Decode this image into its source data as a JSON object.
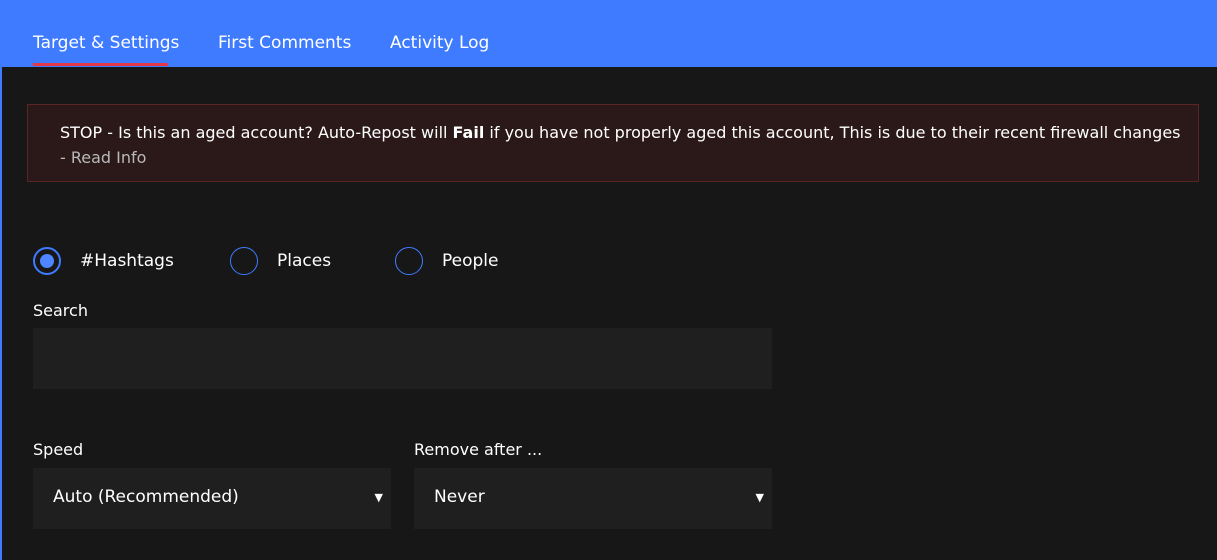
{
  "tabs": {
    "target_settings": "Target & Settings",
    "first_comments": "First Comments",
    "activity_log": "Activity Log"
  },
  "warning": {
    "text_before": "STOP - Is this an aged account? Auto-Repost will ",
    "bold": "Fail",
    "text_after": " if you have not properly aged this account, This is due to their recent firewall changes",
    "link_prefix": "- ",
    "link": "Read Info"
  },
  "target_type": {
    "options": [
      "#Hashtags",
      "Places",
      "People"
    ],
    "selected": "#Hashtags"
  },
  "search": {
    "label": "Search",
    "value": "",
    "placeholder": ""
  },
  "speed": {
    "label": "Speed",
    "value": "Auto (Recommended)"
  },
  "remove_after": {
    "label": "Remove after ...",
    "value": "Never"
  },
  "icons": {
    "dropdown": "caret-down-icon"
  },
  "colors": {
    "accent": "#3f7bff",
    "tab_active_underline": "#e4374a",
    "warning_bg": "#2b1919",
    "warning_border": "#5a2525",
    "background": "#171717",
    "field_bg": "#1f1f1f"
  }
}
